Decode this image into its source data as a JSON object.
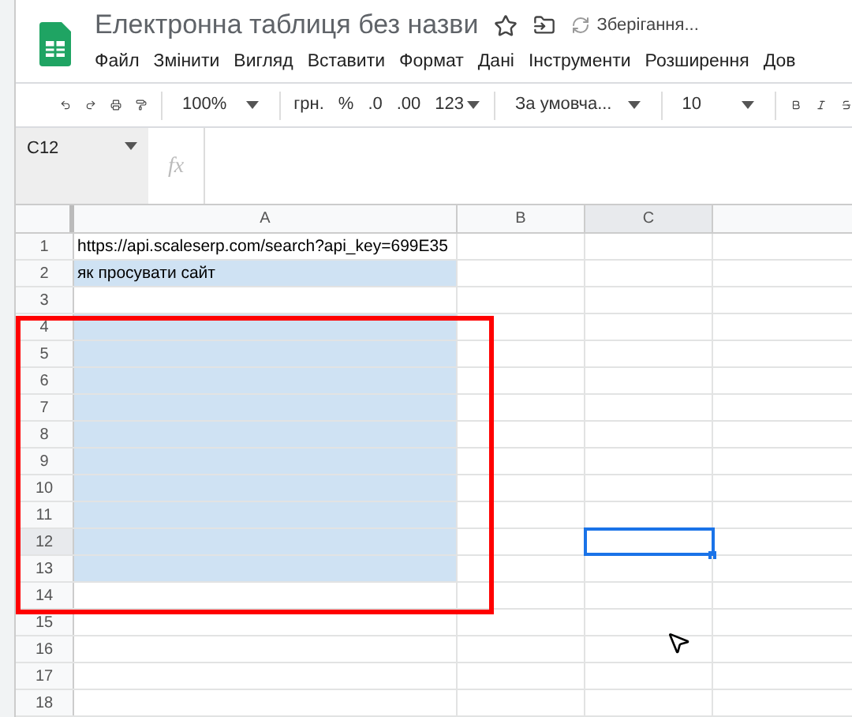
{
  "title": "Електронна таблиця без назви",
  "save_status": "Зберігання...",
  "menu": [
    "Файл",
    "Змінити",
    "Вигляд",
    "Вставити",
    "Формат",
    "Дані",
    "Інструменти",
    "Розширення",
    "Дов"
  ],
  "toolbar": {
    "zoom": "100%",
    "currency": "грн.",
    "percent": "%",
    "decrease_decimals": ".0",
    "increase_decimals": ".00",
    "more_formats": "123",
    "font": "За умовча...",
    "font_size": "10"
  },
  "name_box": "C12",
  "formula_label": "fx",
  "columns": [
    {
      "label": "A",
      "selected": false
    },
    {
      "label": "B",
      "selected": false
    },
    {
      "label": "C",
      "selected": true
    }
  ],
  "rows": [
    {
      "number": "1",
      "selected": false,
      "a": "https://api.scaleserp.com/search?api_key=699E35",
      "a_selected": false,
      "c_active": false
    },
    {
      "number": "2",
      "selected": false,
      "a": "як просувати сайт",
      "a_selected": true,
      "c_active": false
    },
    {
      "number": "3",
      "selected": false,
      "a_selected": false,
      "c_active": false
    },
    {
      "number": "4",
      "selected": false,
      "a_selected": true,
      "c_active": false
    },
    {
      "number": "5",
      "selected": false,
      "a_selected": true,
      "c_active": false
    },
    {
      "number": "6",
      "selected": false,
      "a_selected": true,
      "c_active": false
    },
    {
      "number": "7",
      "selected": false,
      "a_selected": true,
      "c_active": false
    },
    {
      "number": "8",
      "selected": false,
      "a_selected": true,
      "c_active": false
    },
    {
      "number": "9",
      "selected": false,
      "a_selected": true,
      "c_active": false
    },
    {
      "number": "10",
      "selected": false,
      "a_selected": true,
      "c_active": false
    },
    {
      "number": "11",
      "selected": false,
      "a_selected": true,
      "c_active": false
    },
    {
      "number": "12",
      "selected": true,
      "a_selected": true,
      "c_active": true
    },
    {
      "number": "13",
      "selected": false,
      "a_selected": true,
      "c_active": false
    },
    {
      "number": "14",
      "selected": false,
      "a_selected": false,
      "c_active": false
    },
    {
      "number": "15",
      "selected": false,
      "a_selected": false,
      "c_active": false
    },
    {
      "number": "16",
      "selected": false,
      "a_selected": false,
      "c_active": false
    },
    {
      "number": "17",
      "selected": false,
      "a_selected": false,
      "c_active": false
    },
    {
      "number": "18",
      "selected": false,
      "a_selected": false,
      "c_active": false
    }
  ]
}
